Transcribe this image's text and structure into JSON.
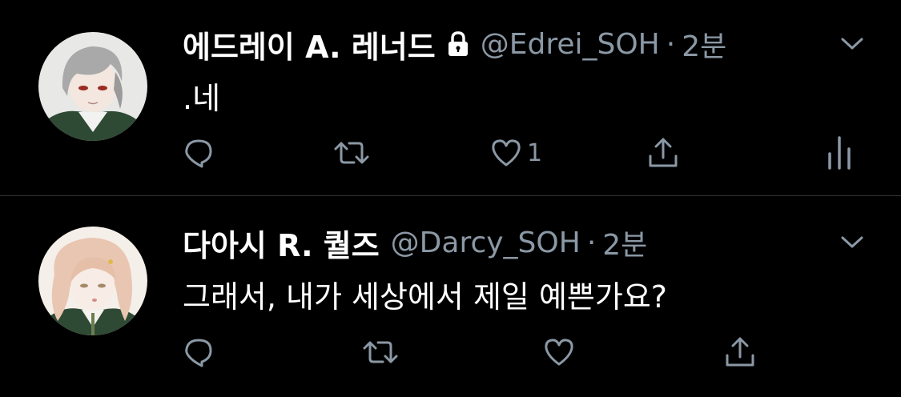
{
  "tweets": [
    {
      "name": "에드레이 A. 레너드",
      "protected": true,
      "handle": "@Edrei_SOH",
      "separator": "·",
      "time": "2분",
      "text": ".네",
      "actions": {
        "reply_icon": "reply-icon",
        "retweet_icon": "retweet-icon",
        "like_icon": "heart-icon",
        "like_count": "1",
        "share_icon": "share-icon",
        "analytics_icon": "analytics-icon"
      }
    },
    {
      "name": "다아시 R. 퀄즈",
      "protected": false,
      "handle": "@Darcy_SOH",
      "separator": "·",
      "time": "2분",
      "text": "그래서, 내가 세상에서 제일 예쁜가요?",
      "actions": {
        "reply_icon": "reply-icon",
        "retweet_icon": "retweet-icon",
        "like_icon": "heart-icon",
        "share_icon": "share-icon"
      }
    }
  ],
  "colors": {
    "background": "#000000",
    "primary_text": "#ffffff",
    "secondary_text": "#8b98a5",
    "divider": "#2f3336"
  }
}
